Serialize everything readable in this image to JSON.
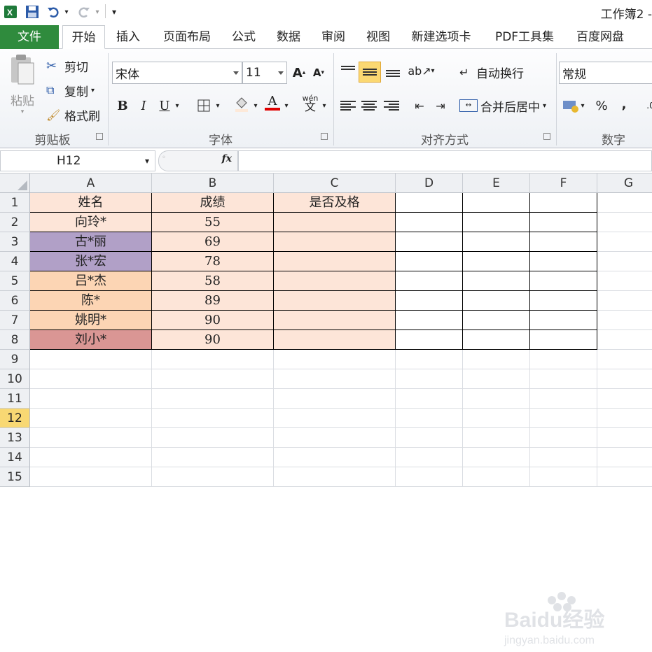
{
  "app": {
    "title": "工作簿2 -"
  },
  "tabs": [
    "文件",
    "开始",
    "插入",
    "页面布局",
    "公式",
    "数据",
    "审阅",
    "视图",
    "新建选项卡",
    "PDF工具集",
    "百度网盘"
  ],
  "ribbon": {
    "clipboard": {
      "paste": "粘贴",
      "cut": "剪切",
      "copy": "复制",
      "format_painter": "格式刷",
      "title": "剪贴板"
    },
    "font": {
      "name": "宋体",
      "size": "11",
      "bold": "B",
      "italic": "I",
      "underline": "U",
      "font_color": "A",
      "phonetic": "wén",
      "title": "字体"
    },
    "alignment": {
      "wrap": "自动换行",
      "merge": "合并后居中",
      "title": "对齐方式"
    },
    "number": {
      "format": "常规",
      "percent": "%",
      "comma": ",",
      "title": "数字"
    }
  },
  "formula_bar": {
    "name_box": "H12",
    "fx": "fx",
    "formula": ""
  },
  "columns": [
    "A",
    "B",
    "C",
    "D",
    "E",
    "F",
    "G"
  ],
  "rows": [
    "1",
    "2",
    "3",
    "4",
    "5",
    "6",
    "7",
    "8",
    "9",
    "10",
    "11",
    "12",
    "13",
    "14",
    "15"
  ],
  "selected_row": "12",
  "cells": {
    "headers": [
      "姓名",
      "成绩",
      "是否及格"
    ],
    "names": [
      "向玲*",
      "古*丽",
      "张*宏",
      "吕*杰",
      "陈*",
      "姚明*",
      "刘小*"
    ],
    "scores": [
      "55",
      "69",
      "78",
      "58",
      "89",
      "90",
      "90"
    ]
  },
  "colors": {
    "file_tab": "#2f8b3d",
    "peach": "#fde5d8",
    "purple": "#b1a0c7",
    "orange": "#fcd5b4",
    "red": "#da9694",
    "selected_row": "#f8d873"
  },
  "watermark": {
    "brand": "Baidu经验",
    "url": "jingyan.baidu.com"
  }
}
